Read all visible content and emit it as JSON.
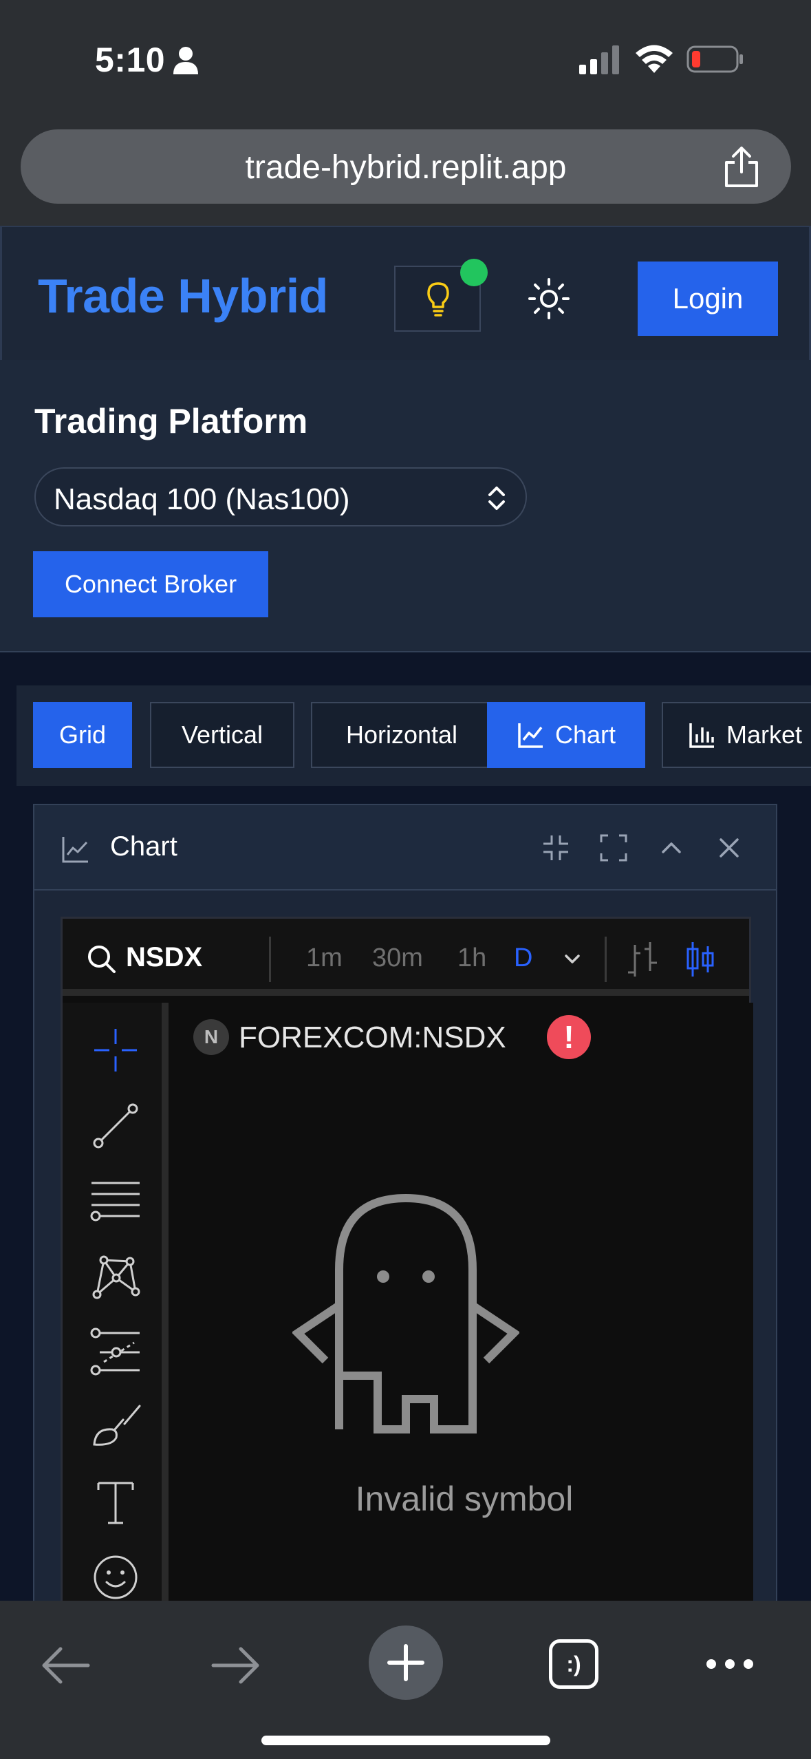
{
  "status_bar": {
    "time": "5:10"
  },
  "browser": {
    "url": "trade-hybrid.replit.app",
    "tabs_label": ":)"
  },
  "header": {
    "brand": "Trade Hybrid",
    "login_label": "Login"
  },
  "platform": {
    "title": "Trading Platform",
    "symbol_selected": "Nasdaq 100 (Nas100)",
    "connect_label": "Connect Broker"
  },
  "layouts": [
    "Grid",
    "Vertical",
    "Horizontal",
    "Chart",
    "Market"
  ],
  "active_layouts": [
    "Grid",
    "Chart"
  ],
  "panel": {
    "title": "Chart"
  },
  "tv": {
    "symbol": "NSDX",
    "timeframes": [
      "1m",
      "30m",
      "1h",
      "D"
    ],
    "active_timeframe": "D",
    "badge_letter": "N",
    "full_symbol": "FOREXCOM:NSDX",
    "warning": "!",
    "message": "Invalid symbol"
  },
  "colors": {
    "accent": "#2563eb",
    "brand": "#3b82f6",
    "online": "#22c55e",
    "warning": "#ef4b5a",
    "tv_active": "#2962ff"
  }
}
